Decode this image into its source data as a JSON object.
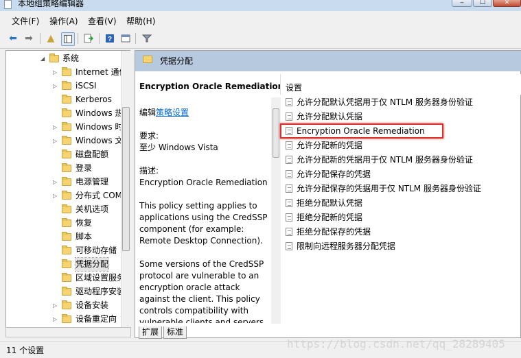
{
  "window": {
    "title": "本地组策略编辑器",
    "min": "‒",
    "max": "☐",
    "close": "✕"
  },
  "menu": [
    "文件(F)",
    "操作(A)",
    "查看(V)",
    "帮助(H)"
  ],
  "tree": {
    "items": [
      {
        "label": "系统",
        "expander": "◢"
      },
      {
        "label": "Internet 通信",
        "expander": "▷"
      },
      {
        "label": "iSCSI",
        "expander": "▷"
      },
      {
        "label": "Kerberos",
        "expander": ""
      },
      {
        "label": "Windows 热",
        "expander": ""
      },
      {
        "label": "Windows 时",
        "expander": "▷"
      },
      {
        "label": "Windows 文",
        "expander": "▷"
      },
      {
        "label": "磁盘配额",
        "expander": ""
      },
      {
        "label": "登录",
        "expander": ""
      },
      {
        "label": "电源管理",
        "expander": "▷"
      },
      {
        "label": "分布式 COM",
        "expander": "▷"
      },
      {
        "label": "关机选项",
        "expander": ""
      },
      {
        "label": "恢复",
        "expander": ""
      },
      {
        "label": "脚本",
        "expander": ""
      },
      {
        "label": "可移动存储",
        "expander": ""
      },
      {
        "label": "凭据分配",
        "expander": "",
        "selected": true
      },
      {
        "label": "区域设置服务",
        "expander": ""
      },
      {
        "label": "驱动程序安装",
        "expander": ""
      },
      {
        "label": "设备安装",
        "expander": "▷"
      },
      {
        "label": "设备重定向",
        "expander": "▷"
      }
    ]
  },
  "pane": {
    "header": "凭据分配",
    "policy_title": "Encryption Oracle Remediation",
    "edit_prefix": "编辑",
    "edit_link": "策略设置",
    "req_label": "要求:",
    "req_value": "至少 Windows Vista",
    "desc_label": "描述:",
    "desc_value": "Encryption Oracle Remediation",
    "para1": [
      "This policy setting applies to",
      "applications using the CredSSP",
      "component (for example:",
      "Remote Desktop Connection)."
    ],
    "para2": [
      "Some versions of the CredSSP",
      "protocol are vulnerable to an",
      "encryption oracle attack",
      "against the client.  This policy",
      "controls compatibility with",
      "vulnerable clients and servers."
    ],
    "settings_header": "设置",
    "settings": [
      "允许分配默认凭据用于仅 NTLM 服务器身份验证",
      "允许分配默认凭据",
      "Encryption Oracle Remediation",
      "允许分配新的凭据",
      "允许分配新的凭据用于仅 NTLM 服务器身份验证",
      "允许分配保存的凭据",
      "允许分配保存的凭据用于仅 NTLM 服务器身份验证",
      "拒绝分配默认凭据",
      "拒绝分配新的凭据",
      "拒绝分配保存的凭据",
      "限制向远程服务器分配凭据"
    ],
    "tabs": [
      "扩展",
      "标准"
    ]
  },
  "status": "11 个设置",
  "watermark": "https://blog.csdn.net/qq_28289405"
}
